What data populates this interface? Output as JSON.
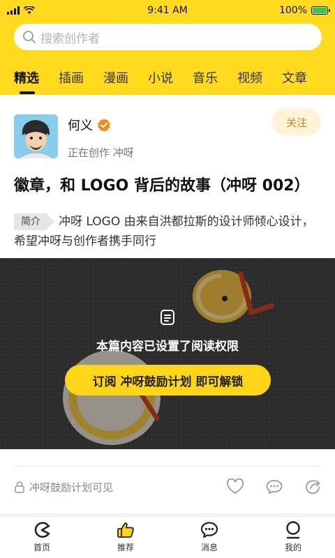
{
  "status_bar": {
    "time": "9:41 AM",
    "battery": "100%"
  },
  "search": {
    "placeholder": "搜索创作者"
  },
  "tabs": [
    {
      "label": "精选",
      "active": true
    },
    {
      "label": "插画",
      "active": false
    },
    {
      "label": "漫画",
      "active": false
    },
    {
      "label": "小说",
      "active": false
    },
    {
      "label": "音乐",
      "active": false
    },
    {
      "label": "视频",
      "active": false
    },
    {
      "label": "文章",
      "active": false
    }
  ],
  "post": {
    "author_name": "何义",
    "author_sub": "正在创作 冲呀",
    "follow_label": "关注",
    "title": "徽章，和 LOGO 背后的故事（冲呀 002）",
    "intro_tag": "简介",
    "intro_text": "冲呀 LOGO 由来自洪都拉斯的设计师倾心设计，希望冲呀与创作者携手同行",
    "lock_text": "本篇内容已设置了阅读权限",
    "unlock_label": "订阅 冲呀鼓励计划 即可解锁",
    "visibility_text": "冲呀鼓励计划可见"
  },
  "bottom_nav": [
    {
      "label": "首页",
      "icon": "home-logo-icon"
    },
    {
      "label": "推荐",
      "icon": "thumbs-up-icon"
    },
    {
      "label": "消息",
      "icon": "message-icon"
    },
    {
      "label": "我的",
      "icon": "profile-icon"
    }
  ],
  "colors": {
    "brand_yellow": "#ffda1f",
    "follow_text": "#c98a1a",
    "verified_orange": "#f08a1c"
  }
}
